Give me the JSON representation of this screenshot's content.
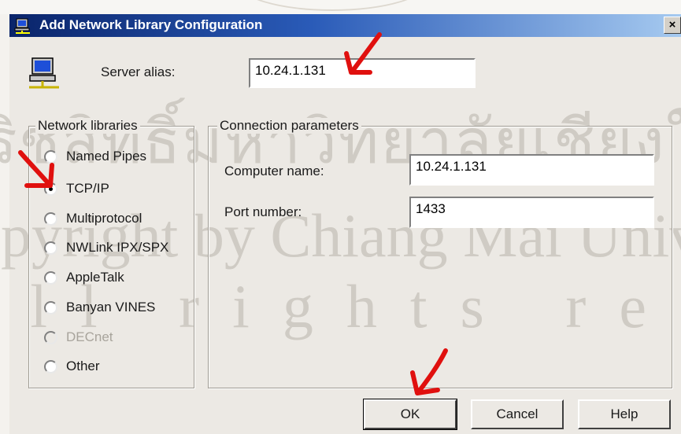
{
  "window": {
    "title": "Add Network Library Configuration",
    "close_label": "×"
  },
  "server": {
    "alias_label": "Server alias:",
    "alias_value": "10.24.1.131"
  },
  "network_libraries": {
    "legend": "Network libraries",
    "options": [
      {
        "label": "Named Pipes",
        "checked": false,
        "disabled": false
      },
      {
        "label": "TCP/IP",
        "checked": true,
        "disabled": false
      },
      {
        "label": "Multiprotocol",
        "checked": false,
        "disabled": false
      },
      {
        "label": "NWLink IPX/SPX",
        "checked": false,
        "disabled": false
      },
      {
        "label": "AppleTalk",
        "checked": false,
        "disabled": false
      },
      {
        "label": "Banyan VINES",
        "checked": false,
        "disabled": false
      },
      {
        "label": "DECnet",
        "checked": false,
        "disabled": true
      },
      {
        "label": "Other",
        "checked": false,
        "disabled": false
      }
    ]
  },
  "connection": {
    "legend": "Connection parameters",
    "computer_name_label": "Computer name:",
    "computer_name_value": "10.24.1.131",
    "port_label": "Port number:",
    "port_value": "1433"
  },
  "buttons": {
    "ok": "OK",
    "cancel": "Cancel",
    "help": "Help"
  },
  "watermark": {
    "line1": "ริชสิทธิ์มหาวิทยาลัยเชียงใหม่",
    "line2": "Copyright by Chiang Mai University",
    "line3": "All rights reserved"
  },
  "colors": {
    "title_gradient_start": "#0a246a",
    "title_gradient_end": "#a6caf0",
    "annotation_arrow": "#e0100e"
  },
  "icons": [
    "network-computer-icon",
    "server-icon",
    "close-icon",
    "annotation-arrow-icon"
  ]
}
